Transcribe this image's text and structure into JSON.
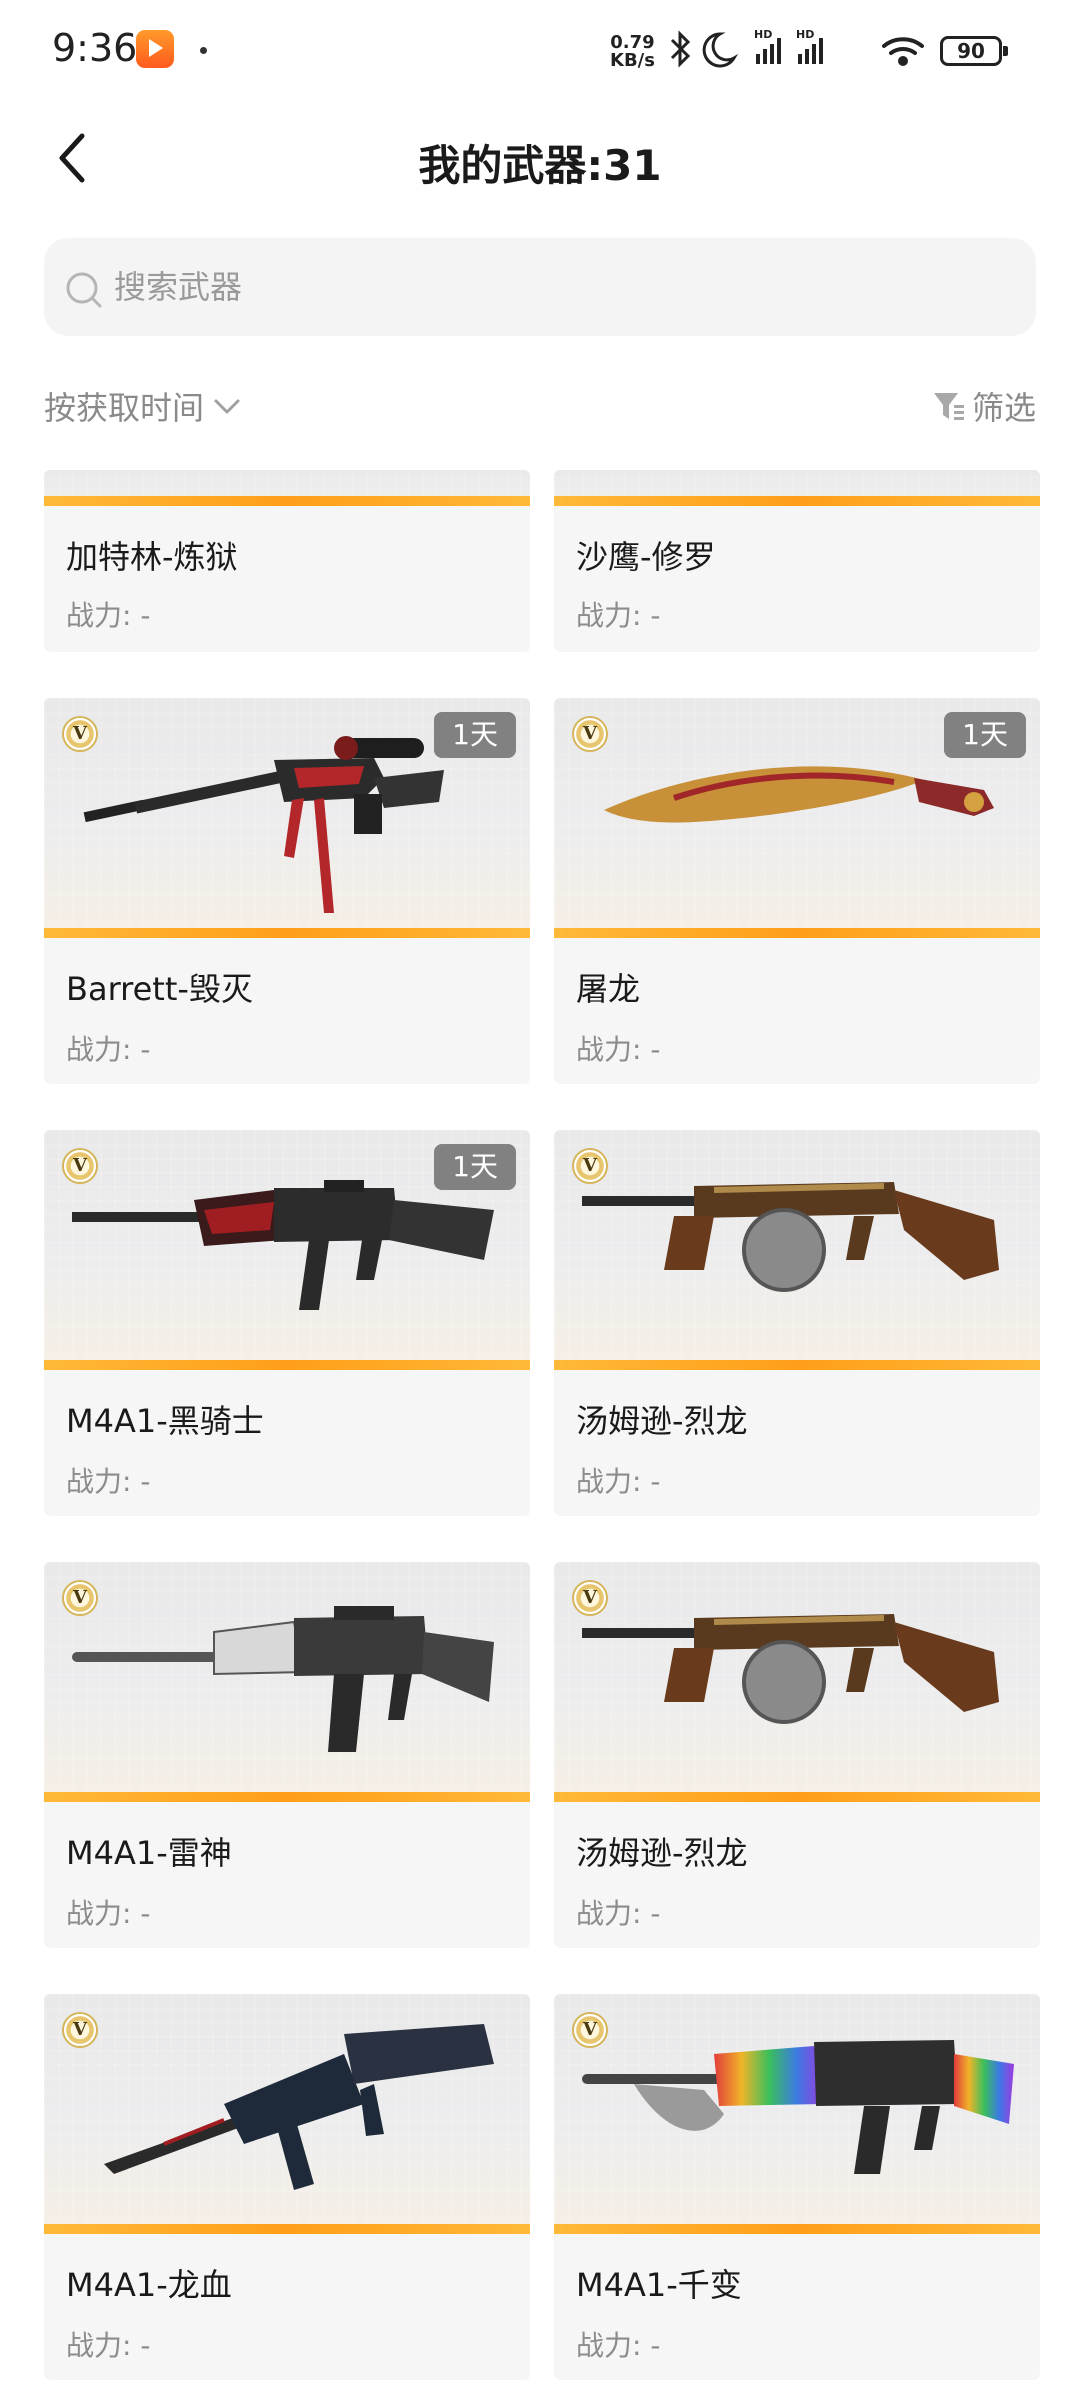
{
  "status_bar": {
    "time": "9:36",
    "net_speed_value": "0.79",
    "net_speed_unit": "KB/s",
    "battery": "90"
  },
  "header": {
    "title": "我的武器:31"
  },
  "search": {
    "placeholder": "搜索武器"
  },
  "toolbar": {
    "sort_label": "按获取时间",
    "filter_label": "筛选"
  },
  "weapons": [
    {
      "name": "加特林-炼狱",
      "power": "战力: -"
    },
    {
      "name": "沙鹰-修罗",
      "power": "战力: -"
    },
    {
      "name": "Barrett-毁灭",
      "power": "战力: -",
      "badge": "V",
      "time": "1天"
    },
    {
      "name": "屠龙",
      "power": "战力: -",
      "badge": "V",
      "time": "1天"
    },
    {
      "name": "M4A1-黑骑士",
      "power": "战力: -",
      "badge": "V",
      "time": "1天"
    },
    {
      "name": "汤姆逊-烈龙",
      "power": "战力: -",
      "badge": "V"
    },
    {
      "name": "M4A1-雷神",
      "power": "战力: -",
      "badge": "V"
    },
    {
      "name": "汤姆逊-烈龙",
      "power": "战力: -",
      "badge": "V"
    },
    {
      "name": "M4A1-龙血",
      "power": "战力: -",
      "badge": "V"
    },
    {
      "name": "M4A1-千变",
      "power": "战力: -",
      "badge": "V"
    }
  ]
}
